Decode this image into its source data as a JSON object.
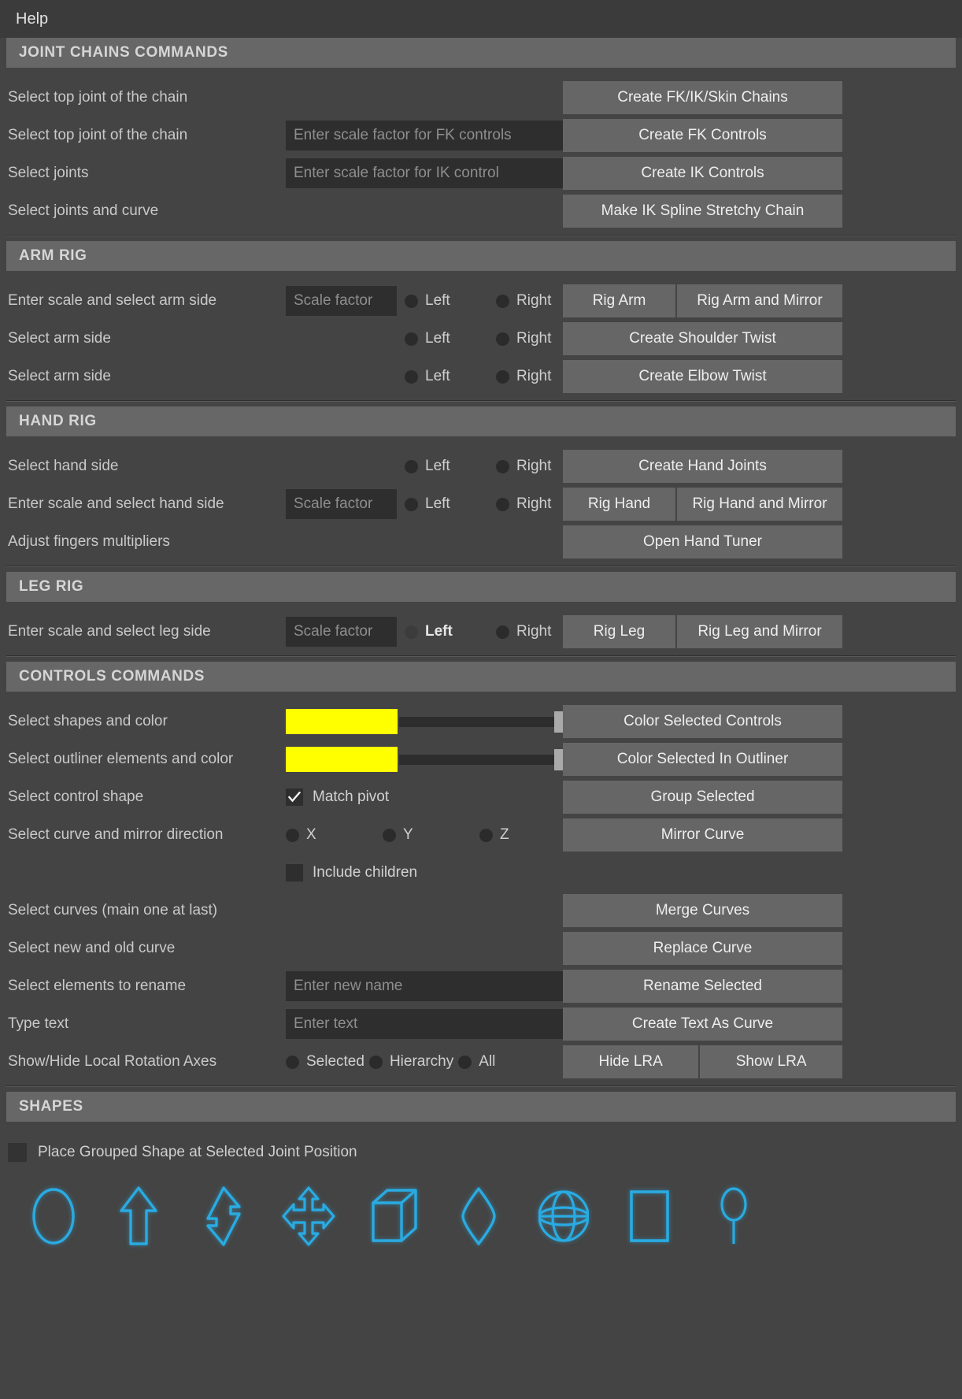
{
  "menubar": {
    "items": [
      {
        "label": "Help"
      }
    ]
  },
  "colors": {
    "window_bg": "#444444",
    "section_header_bg": "#676767",
    "button_bg": "#666666",
    "field_bg": "#2e2e2e",
    "swatch_color": "#FFFF00",
    "icon_accent": "#29abe2",
    "text": "#c9c9c9"
  },
  "sections": {
    "joint_chains": {
      "title": "JOINT CHAINS COMMANDS",
      "rows": [
        {
          "label": "Select top joint of the chain",
          "field": null,
          "buttons": [
            "Create FK/IK/Skin Chains"
          ]
        },
        {
          "label": "Select top joint of the chain",
          "field": "Enter scale factor for FK controls",
          "buttons": [
            "Create FK Controls"
          ]
        },
        {
          "label": "Select joints",
          "field": "Enter scale factor for IK control",
          "buttons": [
            "Create IK Controls"
          ]
        },
        {
          "label": "Select joints and curve",
          "field": null,
          "buttons": [
            "Make IK Spline Stretchy Chain"
          ]
        }
      ]
    },
    "arm_rig": {
      "title": "ARM RIG",
      "rows": [
        {
          "label": "Enter scale and select arm side",
          "field": "Scale factor",
          "radios": [
            {
              "label": "Left",
              "selected": false
            },
            {
              "label": "Right",
              "selected": false
            }
          ],
          "buttons": [
            "Rig Arm",
            "Rig Arm and Mirror"
          ]
        },
        {
          "label": "Select arm side",
          "field": null,
          "radios": [
            {
              "label": "Left",
              "selected": false
            },
            {
              "label": "Right",
              "selected": false
            }
          ],
          "buttons": [
            "Create Shoulder Twist"
          ]
        },
        {
          "label": "Select arm side",
          "field": null,
          "radios": [
            {
              "label": "Left",
              "selected": false
            },
            {
              "label": "Right",
              "selected": false
            }
          ],
          "buttons": [
            "Create Elbow Twist"
          ]
        }
      ]
    },
    "hand_rig": {
      "title": "HAND RIG",
      "rows": [
        {
          "label": "Select hand side",
          "field": null,
          "radios": [
            {
              "label": "Left",
              "selected": false
            },
            {
              "label": "Right",
              "selected": false
            }
          ],
          "buttons": [
            "Create Hand Joints"
          ]
        },
        {
          "label": "Enter scale and select hand side",
          "field": "Scale factor",
          "radios": [
            {
              "label": "Left",
              "selected": false
            },
            {
              "label": "Right",
              "selected": false
            }
          ],
          "buttons": [
            "Rig Hand",
            "Rig Hand and Mirror"
          ]
        },
        {
          "label": "Adjust fingers multipliers",
          "field": null,
          "buttons": [
            "Open Hand Tuner"
          ]
        }
      ]
    },
    "leg_rig": {
      "title": "LEG RIG",
      "rows": [
        {
          "label": "Enter scale and select leg side",
          "field": "Scale factor",
          "radios": [
            {
              "label": "Left",
              "selected": true
            },
            {
              "label": "Right",
              "selected": false
            }
          ],
          "buttons": [
            "Rig Leg",
            "Rig Leg and Mirror"
          ]
        }
      ]
    },
    "controls": {
      "title": "CONTROLS COMMANDS",
      "row_color_shapes": {
        "label": "Select shapes and color",
        "swatch": "#FFFF00",
        "slider_value": 100,
        "button": "Color Selected Controls"
      },
      "row_color_outliner": {
        "label": "Select outliner elements and color",
        "swatch": "#FFFF00",
        "slider_value": 100,
        "button": "Color Selected In Outliner"
      },
      "row_group": {
        "label": "Select control shape",
        "checkbox": {
          "label": "Match pivot",
          "checked": true
        },
        "button": "Group Selected"
      },
      "row_mirror": {
        "label": "Select curve and mirror direction",
        "radios": [
          {
            "label": "X",
            "selected": false
          },
          {
            "label": "Y",
            "selected": false
          },
          {
            "label": "Z",
            "selected": false
          }
        ],
        "button": "Mirror Curve"
      },
      "row_include_children": {
        "checkbox": {
          "label": "Include children",
          "checked": false
        }
      },
      "row_merge": {
        "label": "Select curves (main one at last)",
        "button": "Merge Curves"
      },
      "row_replace": {
        "label": "Select new and old curve",
        "button": "Replace Curve"
      },
      "row_rename": {
        "label": "Select elements to rename",
        "field": "Enter new name",
        "button": "Rename Selected"
      },
      "row_text": {
        "label": "Type text",
        "field": "Enter text",
        "button": "Create Text As Curve"
      },
      "row_lra": {
        "label": "Show/Hide Local Rotation Axes",
        "radios": [
          {
            "label": "Selected",
            "selected": false
          },
          {
            "label": "Hierarchy",
            "selected": false
          },
          {
            "label": "All",
            "selected": false
          }
        ],
        "buttons": [
          "Hide LRA",
          "Show LRA"
        ]
      }
    },
    "shapes": {
      "title": "SHAPES",
      "place_checkbox": {
        "label": "Place Grouped Shape at Selected Joint Position",
        "checked": false
      },
      "icons": [
        {
          "name": "circle-shape-icon"
        },
        {
          "name": "arrow-up-shape-icon"
        },
        {
          "name": "double-arrow-shape-icon"
        },
        {
          "name": "four-way-arrow-shape-icon"
        },
        {
          "name": "cube-shape-icon"
        },
        {
          "name": "diamond-shape-icon"
        },
        {
          "name": "sphere-shape-icon"
        },
        {
          "name": "square-shape-icon"
        },
        {
          "name": "pin-shape-icon"
        }
      ]
    }
  }
}
